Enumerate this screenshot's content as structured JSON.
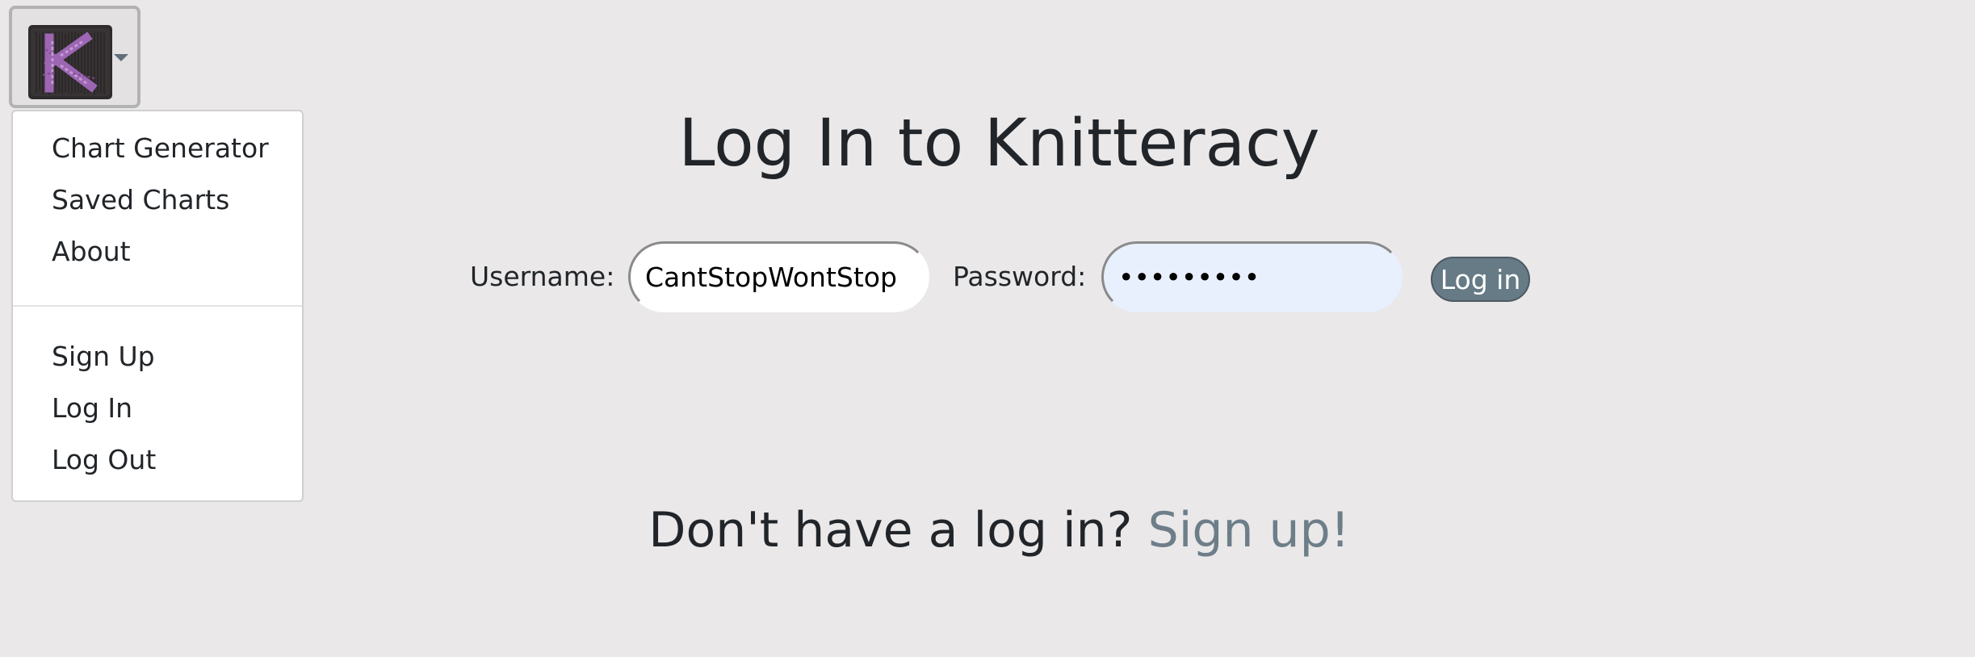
{
  "nav": {
    "logo_letter": "K",
    "menu": {
      "items_top": [
        "Chart Generator",
        "Saved Charts",
        "About"
      ],
      "items_bottom": [
        "Sign Up",
        "Log In",
        "Log Out"
      ]
    }
  },
  "main": {
    "title": "Log In to Knitteracy",
    "username_label": "Username:",
    "username_value": "CantStopWontStop",
    "password_label": "Password:",
    "password_value": "•••••••••",
    "login_button": "Log in",
    "signup_prompt": "Don't have a log in?",
    "signup_link": "Sign up!"
  },
  "colors": {
    "background": "#eae8e9",
    "accent": "#667b86",
    "link": "#6d7e89",
    "autofill": "#e8f0fe"
  },
  "icons": {
    "logo": "knitted-k-logo-icon",
    "caret": "caret-down-icon"
  }
}
